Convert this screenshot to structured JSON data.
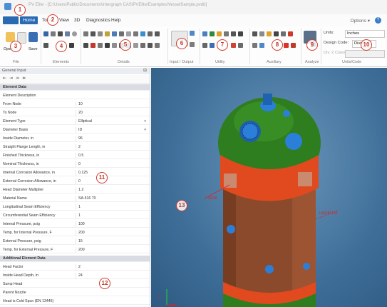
{
  "window": {
    "title": "PV Elite - [C:\\Users\\Public\\Documents\\Intergraph CAS\\PVElite\\Examples\\VesselSample.pvdb]"
  },
  "menu": {
    "tabs": [
      "Home",
      "Tools",
      "View",
      "3D",
      "Diagnostics",
      "Help"
    ],
    "active": "Home",
    "options_label": "Options"
  },
  "ribbon": {
    "file": {
      "open_label": "Open...",
      "save_label": "Save",
      "group_label": "File"
    },
    "groups": [
      "Elements",
      "Details",
      "Input / Output",
      "Utility",
      "Auxiliary",
      "Analyze",
      "Units/Code"
    ],
    "units": {
      "units_label": "Units:",
      "units_value": "Inches",
      "code_label": "Design Code:",
      "code_value": "Division 1",
      "div2_label": "Div. 2 Class:",
      "div2_value": ""
    }
  },
  "panel": {
    "title": "General Input",
    "rows": [
      {
        "k": "Element Data",
        "v": "",
        "sec": true
      },
      {
        "k": "Element Description",
        "v": ""
      },
      {
        "k": "From Node",
        "v": "10"
      },
      {
        "k": "To Node",
        "v": "20"
      },
      {
        "k": "Element Type",
        "v": "Elliptical",
        "dd": true
      },
      {
        "k": "Diameter Basis",
        "v": "ID",
        "dd": true
      },
      {
        "k": "Inside Diameter, in",
        "v": "96"
      },
      {
        "k": "Straight Flange Length, in",
        "v": "2"
      },
      {
        "k": "Finished Thickness, in",
        "v": "0.5"
      },
      {
        "k": "Nominal Thickness, in",
        "v": "0"
      },
      {
        "k": "Internal Corrosion Allowance, in",
        "v": "0.125"
      },
      {
        "k": "External Corrosion Allowance, in",
        "v": "0"
      },
      {
        "k": "Head Diameter Multiplier",
        "v": "1.2"
      },
      {
        "k": "Material Name",
        "v": "SA-516 70"
      },
      {
        "k": "Longitudinal Seam Efficiency",
        "v": "1"
      },
      {
        "k": "Circumferential Seam Efficiency",
        "v": "1"
      },
      {
        "k": "Internal Pressure, psig",
        "v": "100"
      },
      {
        "k": "Temp. for Internal Pressure, F",
        "v": "200"
      },
      {
        "k": "External Pressure, psig",
        "v": "15"
      },
      {
        "k": "Temp. for External Pressure, F",
        "v": "200"
      },
      {
        "k": "Additional Element Data",
        "v": "",
        "sec": true
      },
      {
        "k": "Head Factor",
        "v": "2"
      },
      {
        "k": "Inside Head Depth, in",
        "v": "24"
      },
      {
        "k": "Sump Head",
        "v": ""
      },
      {
        "k": "Parent Nozzle",
        "v": ""
      },
      {
        "k": "Head is Cold Spun (EN 13445)",
        "v": ""
      }
    ]
  },
  "viewport": {
    "dim_label": "24.00",
    "liquid_label": "LIQUID LVL",
    "axis_z": "Z",
    "axis_x": "X"
  },
  "badges": [
    "1",
    "2",
    "3",
    "4",
    "5",
    "6",
    "7",
    "8",
    "9",
    "10",
    "11",
    "12",
    "13"
  ],
  "colors": {
    "accent": "#2a6ab3",
    "badge": "#d43a2a",
    "shell": "#8b4a2c",
    "head": "#2e7d1f",
    "band": "#e04a1e",
    "nozzle": "#2b7fd8"
  }
}
